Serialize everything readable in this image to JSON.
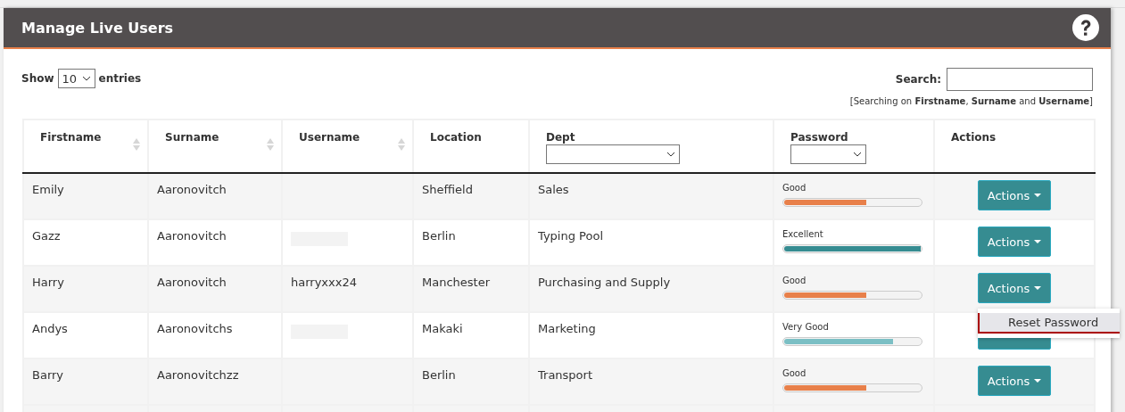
{
  "panel": {
    "title": "Manage Live Users"
  },
  "controls": {
    "show_label": "Show",
    "page_size": "10",
    "entries_label": "entries",
    "search_label": "Search:",
    "search_hint": "[Searching on **Firstname**, **Surname** and **Username**]"
  },
  "table": {
    "columns": [
      {
        "label": "Firstname",
        "kind": "sortable"
      },
      {
        "label": "Surname",
        "kind": "sortable"
      },
      {
        "label": "Username",
        "kind": "sortable"
      },
      {
        "label": "Location",
        "kind": "plain"
      },
      {
        "label": "Dept",
        "kind": "filter"
      },
      {
        "label": "Password",
        "kind": "filter"
      },
      {
        "label": "Actions",
        "kind": "plain"
      }
    ],
    "rows": [
      {
        "firstname": "Emily",
        "surname": "Aaronovitch",
        "location": "Sheffield",
        "dept": "Sales",
        "password": {
          "label": "Good",
          "level": 0.6,
          "color": "#e8804a"
        },
        "actions": "Actions"
      },
      {
        "firstname": "Gazz",
        "surname": "Aaronovitch",
        "username_redacted": true,
        "location": "Berlin",
        "dept": "Typing Pool",
        "password": {
          "label": "Excellent",
          "level": 1,
          "color": "#368c91"
        },
        "actions": "Actions"
      },
      {
        "firstname": "Harry",
        "surname": "Aaronovitch",
        "username": "harryxxx24",
        "location": "Manchester",
        "dept": "Purchasing and Supply",
        "password": {
          "label": "Good",
          "level": 0.6,
          "color": "#e8804a"
        },
        "actions": "Actions",
        "menu": [
          "Reset Password"
        ]
      },
      {
        "firstname": "Andys",
        "surname": "Aaronovitchs",
        "username_redacted": true,
        "location": "Makaki",
        "dept": "Marketing",
        "password": {
          "label": "Very Good",
          "level": 0.8,
          "color": "#7bbfc4"
        }
      },
      {
        "firstname": "Barry",
        "surname": "Aaronovitchzz",
        "location": "Berlin",
        "dept": "Transport",
        "password": {
          "label": "Good",
          "level": 0.6,
          "color": "#e8804a"
        },
        "actions": "Actions"
      }
    ]
  }
}
